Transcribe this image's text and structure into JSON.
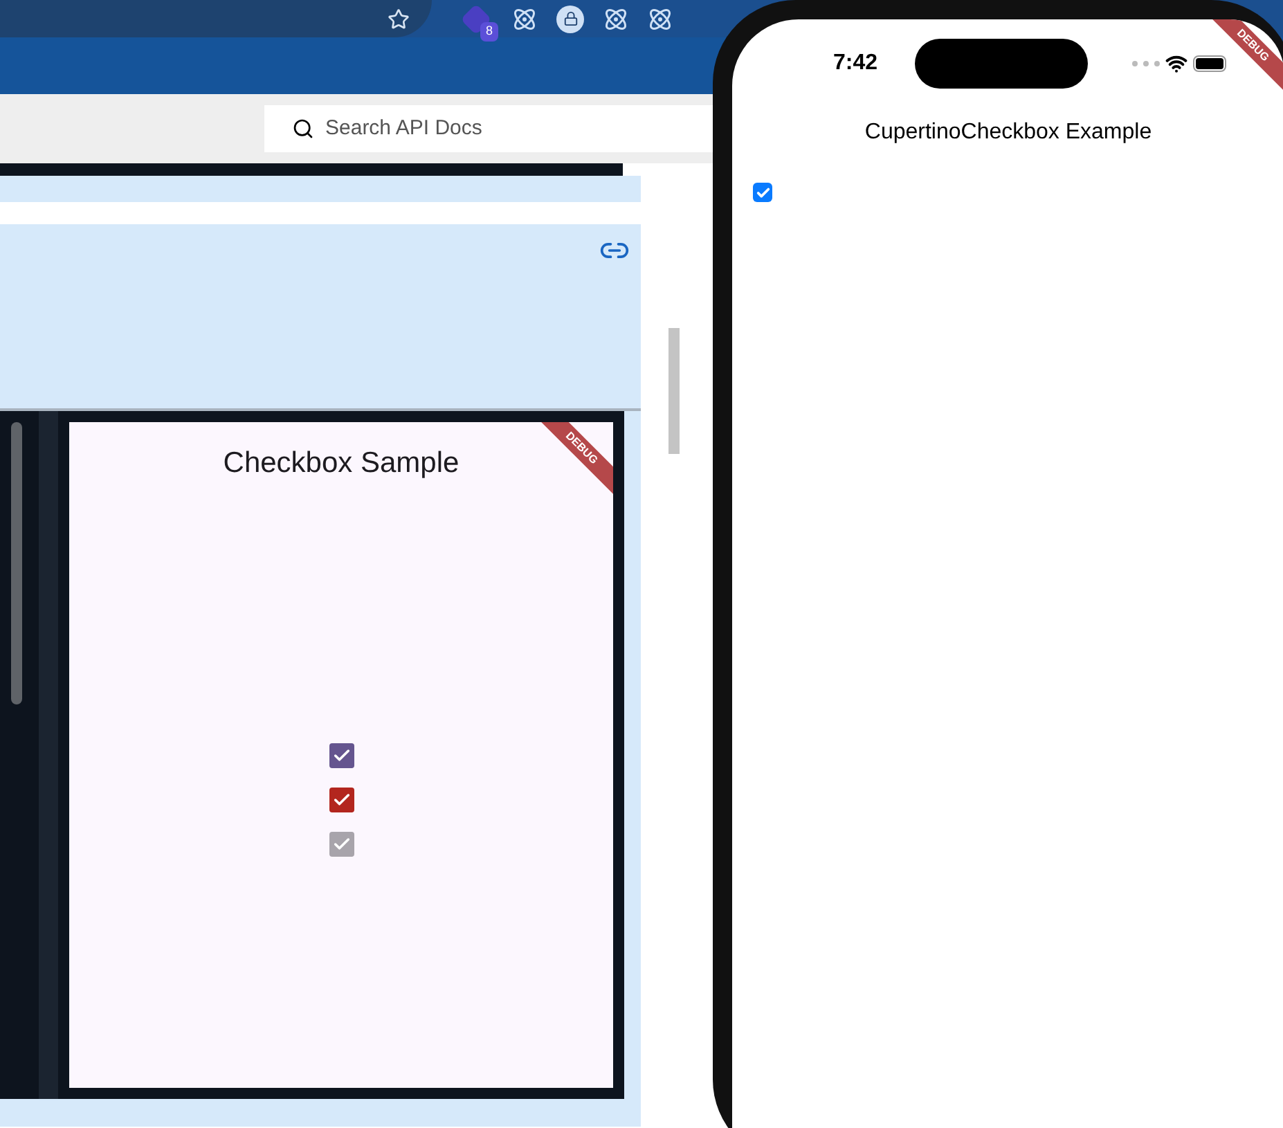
{
  "browser": {
    "extension_badges": [
      {
        "kind": "badge",
        "text": "8"
      },
      {
        "kind": "plain"
      },
      {
        "kind": "lock"
      },
      {
        "kind": "plain"
      },
      {
        "kind": "plain"
      }
    ]
  },
  "docs": {
    "search": {
      "placeholder": "Search API Docs"
    },
    "sample_app": {
      "title": "Checkbox Sample",
      "banner": "DEBUG",
      "checkboxes": [
        {
          "checked": true,
          "color": "#65558f"
        },
        {
          "checked": true,
          "color": "#b3261e"
        },
        {
          "checked": true,
          "color": "#a8a4ab"
        }
      ]
    }
  },
  "phone": {
    "time": "7:42",
    "banner": "DEBUG",
    "title": "CupertinoCheckbox Example",
    "checkbox": {
      "checked": true
    }
  }
}
